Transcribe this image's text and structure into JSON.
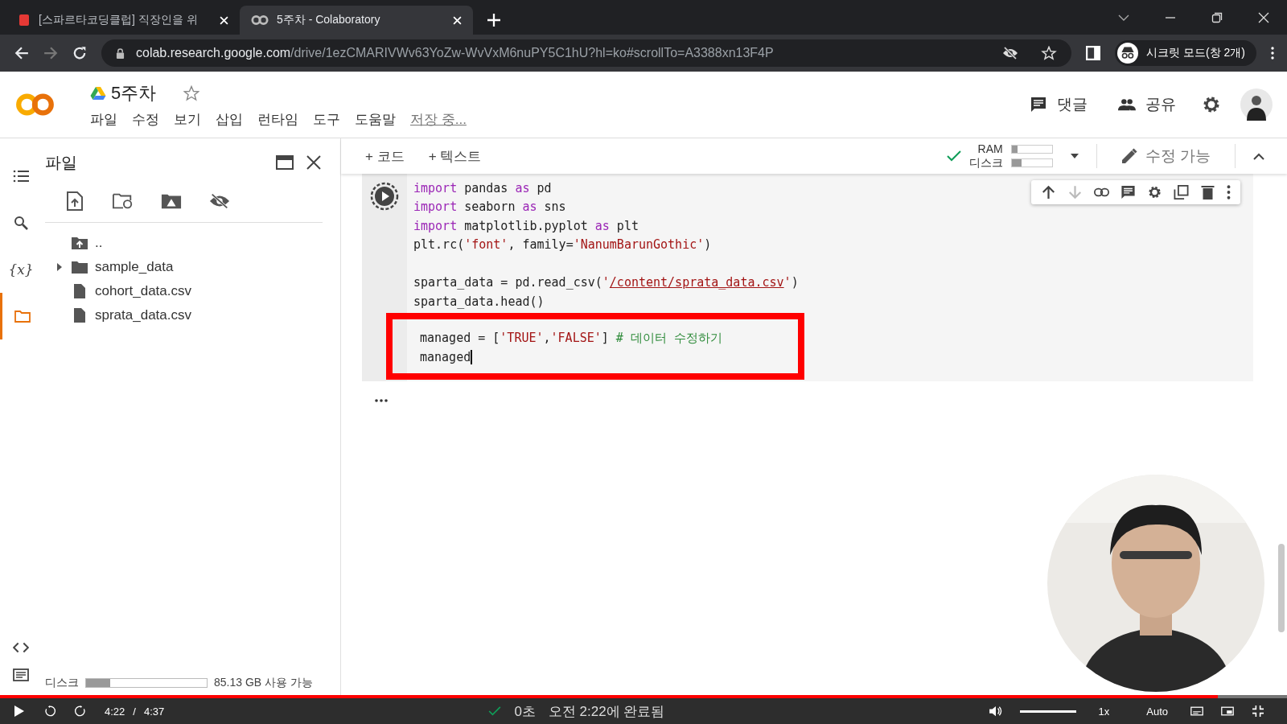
{
  "browser": {
    "tabs": [
      {
        "title": "[스파르타코딩클럽] 직장인을 위",
        "selected": false
      },
      {
        "title": "5주차 - Colaboratory",
        "selected": true
      }
    ],
    "url": {
      "host": "colab.research.google.com",
      "path": "/drive/1ezCMARIVWv63YoZw-WvVxM6nuPY5C1hU?hl=ko#scrollTo=A3388xn13F4P"
    },
    "profile": "시크릿 모드(창 2개)"
  },
  "notebook": {
    "title": "5주차",
    "menu": [
      "파일",
      "수정",
      "보기",
      "삽입",
      "런타임",
      "도구",
      "도움말"
    ],
    "save_status": "저장 중...",
    "comment": "댓글",
    "share": "공유"
  },
  "toolbar": {
    "add_code": "+ 코드",
    "add_text": "+ 텍스트",
    "ram": {
      "label": "RAM",
      "level": 0.15
    },
    "disk": {
      "label": "디스크",
      "level": 0.25
    },
    "edit_mode": "수정 가능"
  },
  "sidebar": {
    "nav": [
      {
        "kind": "toc",
        "selected": false
      },
      {
        "kind": "search",
        "selected": false
      },
      {
        "kind": "variables",
        "label": "{x}",
        "selected": false
      },
      {
        "kind": "files",
        "selected": true
      }
    ],
    "title": "파일",
    "files": [
      {
        "name": "..",
        "kind": "parent"
      },
      {
        "name": "sample_data",
        "kind": "folder",
        "expanded": false
      },
      {
        "name": "cohort_data.csv",
        "kind": "file"
      },
      {
        "name": "sprata_data.csv",
        "kind": "file"
      }
    ],
    "disk": {
      "label": "디스크",
      "level": 0.2,
      "free": "85.13 GB 사용 가능"
    }
  },
  "cell": {
    "blocks": [
      {
        "highlighted": false,
        "lines": [
          {
            "kind": "code",
            "cursor": false,
            "tokens": [
              {
                "kind": "kw",
                "s": "import"
              },
              {
                "kind": "plain",
                "s": " pandas "
              },
              {
                "kind": "kw",
                "s": "as"
              },
              {
                "kind": "plain",
                "s": " pd"
              }
            ]
          },
          {
            "kind": "code",
            "cursor": false,
            "tokens": [
              {
                "kind": "kw",
                "s": "import"
              },
              {
                "kind": "plain",
                "s": " seaborn "
              },
              {
                "kind": "kw",
                "s": "as"
              },
              {
                "kind": "plain",
                "s": " sns"
              }
            ]
          },
          {
            "kind": "code",
            "cursor": false,
            "tokens": [
              {
                "kind": "kw",
                "s": "import"
              },
              {
                "kind": "plain",
                "s": " matplotlib.pyplot "
              },
              {
                "kind": "kw",
                "s": "as"
              },
              {
                "kind": "plain",
                "s": " plt"
              }
            ]
          },
          {
            "kind": "code",
            "cursor": false,
            "tokens": [
              {
                "kind": "plain",
                "s": "plt.rc("
              },
              {
                "kind": "str",
                "s": "'font'"
              },
              {
                "kind": "plain",
                "s": ", family="
              },
              {
                "kind": "str",
                "s": "'NanumBarunGothic'"
              },
              {
                "kind": "plain",
                "s": ")"
              }
            ]
          },
          {
            "kind": "blank"
          },
          {
            "kind": "code",
            "cursor": false,
            "tokens": [
              {
                "kind": "plain",
                "s": "sparta_data = pd.read_csv("
              },
              {
                "kind": "str",
                "s": "'"
              },
              {
                "kind": "link",
                "s": "/content/sprata_data.csv"
              },
              {
                "kind": "str",
                "s": "'"
              },
              {
                "kind": "plain",
                "s": ")"
              }
            ]
          },
          {
            "kind": "code",
            "cursor": false,
            "tokens": [
              {
                "kind": "plain",
                "s": "sparta_data.head()"
              }
            ]
          }
        ]
      },
      {
        "highlighted": true,
        "lines": [
          {
            "kind": "code",
            "cursor": false,
            "tokens": [
              {
                "kind": "plain",
                "s": "managed = ["
              },
              {
                "kind": "str",
                "s": "'TRUE'"
              },
              {
                "kind": "plain",
                "s": ","
              },
              {
                "kind": "str",
                "s": "'FALSE'"
              },
              {
                "kind": "plain",
                "s": "] "
              },
              {
                "kind": "comment",
                "s": "# 데이터 수정하기"
              }
            ]
          },
          {
            "kind": "code",
            "cursor": true,
            "tokens": [
              {
                "kind": "plain",
                "s": "managed"
              }
            ]
          }
        ]
      }
    ]
  },
  "status_bar": {
    "elapsed": "0초",
    "completed": "오전 2:22에 완료됨"
  },
  "player": {
    "progress": {
      "level": 0.946
    },
    "time": "4:22",
    "separator": "/",
    "duration": "4:37",
    "volume": {
      "level": 1
    },
    "speed": "1x",
    "quality": "Auto"
  }
}
